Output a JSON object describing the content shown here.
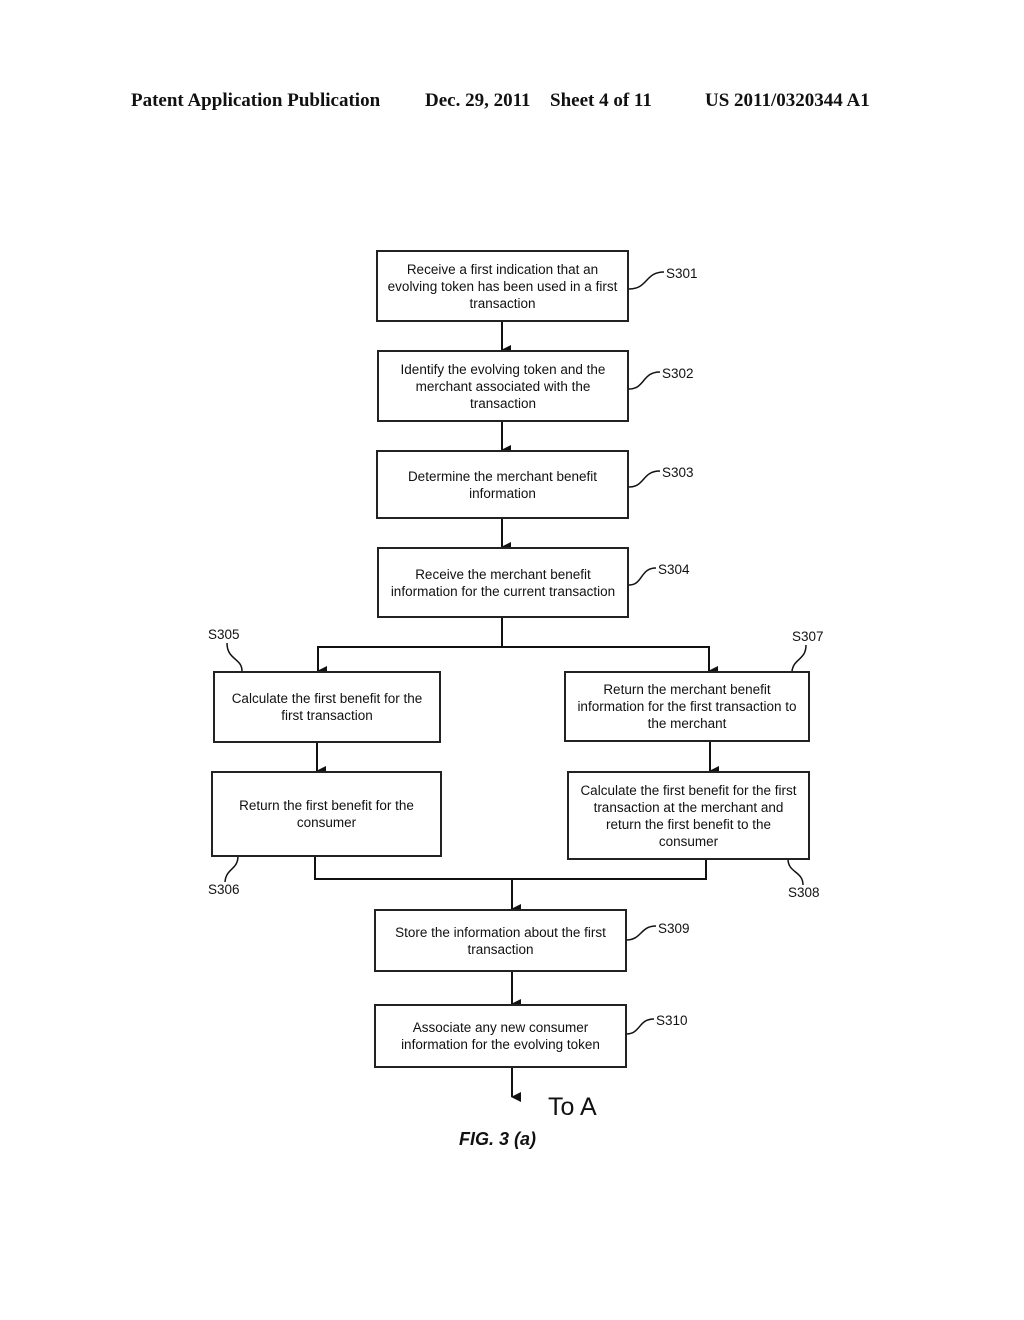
{
  "header": {
    "publication": "Patent Application Publication",
    "date": "Dec. 29, 2011",
    "sheet": "Sheet 4 of 11",
    "number": "US 2011/0320344 A1"
  },
  "steps": {
    "s301": {
      "id": "S301",
      "text": "Receive a first indication that an evolving token has been used in a first transaction"
    },
    "s302": {
      "id": "S302",
      "text": "Identify the evolving token and the merchant associated with the transaction"
    },
    "s303": {
      "id": "S303",
      "text": "Determine the merchant benefit information"
    },
    "s304": {
      "id": "S304",
      "text": "Receive the merchant benefit information for the current transaction"
    },
    "s305": {
      "id": "S305",
      "text": "Calculate the first benefit for the first transaction"
    },
    "s306": {
      "id": "S306",
      "text": "Return the first benefit for the consumer"
    },
    "s307": {
      "id": "S307",
      "text": "Return the merchant benefit information for the first transaction to the merchant"
    },
    "s308": {
      "id": "S308",
      "text": "Calculate the first benefit for the first transaction at the merchant and return the first benefit to the consumer"
    },
    "s309": {
      "id": "S309",
      "text": "Store the information about the first transaction"
    },
    "s310": {
      "id": "S310",
      "text": "Associate any new consumer information for the evolving token"
    }
  },
  "connector": "To A",
  "figure_caption": "FIG. 3 (a)"
}
